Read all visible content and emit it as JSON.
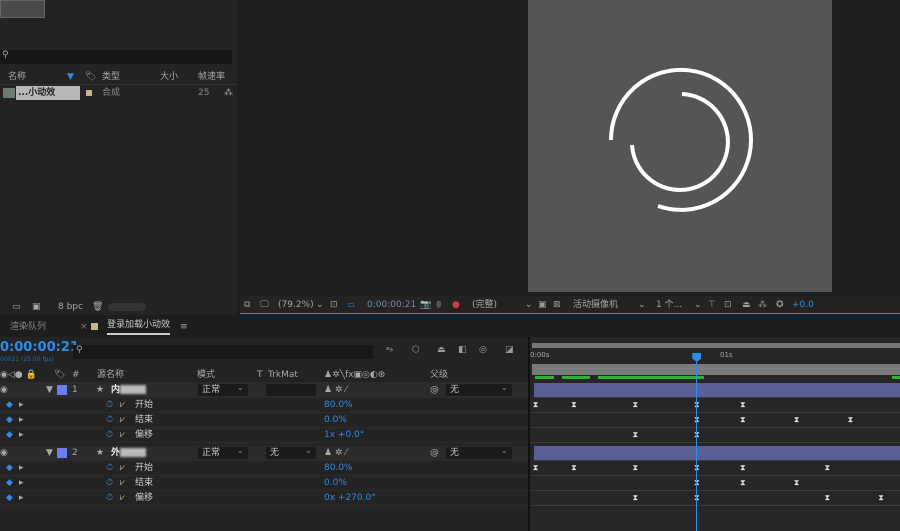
{
  "project": {
    "search_placeholder": "",
    "columns": [
      "名称",
      "类型",
      "大小",
      "帧速率"
    ],
    "items": [
      {
        "name": "...小动效",
        "type": "合成",
        "size": "",
        "fps": "25"
      }
    ],
    "bpc": "8 bpc"
  },
  "viewer": {
    "zoom": "(79.2%)",
    "timecode": "0:00:00:21",
    "resolution": "(完整)",
    "camera": "活动摄像机",
    "views": "1 个...",
    "exposure": "+0.0",
    "comp_bg": "#555555",
    "stroke_color": "#ffffff"
  },
  "timeline": {
    "tabs": [
      {
        "label": "渲染队列"
      },
      {
        "label": "登录加载小动效"
      }
    ],
    "timecode": "0:00:00:21",
    "timecode_sub": "00021 (25.00 fps)",
    "columns": {
      "num": "#",
      "source": "源名称",
      "mode": "模式",
      "t": "T",
      "trkmat": "TrkMat",
      "parent": "父级"
    },
    "ruler": [
      "0:00s",
      "01s"
    ],
    "playhead_frame": 21,
    "fps": 25,
    "layers": [
      {
        "num": "1",
        "name": "内",
        "mode": "正常",
        "trkmat": "",
        "parent": "无",
        "color": "#6f7cf0",
        "props": [
          {
            "name": "开始",
            "value": "80.0%",
            "keyframes": [
              0,
              5,
              13,
              21,
              27
            ]
          },
          {
            "name": "结束",
            "value": "0.0%",
            "keyframes": [
              21,
              27,
              34,
              41
            ]
          },
          {
            "name": "偏移",
            "value": "1x +0.0°",
            "keyframes": [
              13,
              21
            ]
          }
        ]
      },
      {
        "num": "2",
        "name": "外",
        "mode": "正常",
        "trkmat": "无",
        "parent": "无",
        "color": "#6f7cf0",
        "props": [
          {
            "name": "开始",
            "value": "80.0%",
            "keyframes": [
              0,
              5,
              13,
              21,
              27,
              38
            ]
          },
          {
            "name": "结束",
            "value": "0.0%",
            "keyframes": [
              21,
              27,
              34
            ]
          },
          {
            "name": "偏移",
            "value": "0x +270.0°",
            "keyframes": [
              13,
              21,
              38,
              45
            ]
          }
        ]
      }
    ]
  }
}
